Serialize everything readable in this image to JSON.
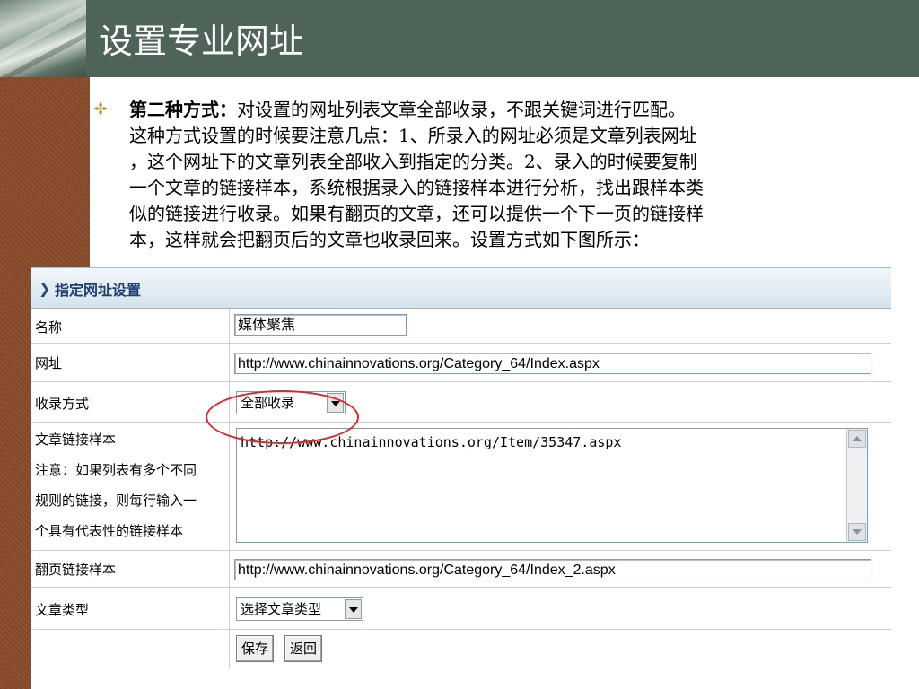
{
  "slide": {
    "title": "设置专业网址",
    "paragraph": {
      "lead": "第二种方式：",
      "line1_rest": "对设置的网址列表文章全部收录，不跟关键词进行匹配。",
      "line2": "这种方式设置的时候要注意几点：1、所录入的网址必须是文章列表网址",
      "line3": "，这个网址下的文章列表全部收入到指定的分类。2、录入的时候要复制",
      "line4": "一个文章的链接样本，系统根据录入的链接样本进行分析，找出跟样本类",
      "line5": "似的链接进行收录。如果有翻页的文章，还可以提供一个下一页的链接样",
      "line6": "本，这样就会把翻页后的文章也收录回来。设置方式如下图所示："
    }
  },
  "form": {
    "panel_title": "指定网址设置",
    "name_label": "名称",
    "name_value": "媒体聚焦",
    "url_label": "网址",
    "url_value": "http://www.chinainnovations.org/Category_64/Index.aspx",
    "mode_label": "收录方式",
    "mode_value": "全部收录",
    "sample_label_1": "文章链接样本",
    "sample_label_2": "注意：如果列表有多个不同",
    "sample_label_3": "规则的链接，则每行输入一",
    "sample_label_4": "个具有代表性的链接样本",
    "sample_value": "http://www.chinainnovations.org/Item/35347.aspx",
    "page_label": "翻页链接样本",
    "page_value": "http://www.chinainnovations.org/Category_64/Index_2.aspx",
    "type_label": "文章类型",
    "type_value": "选择文章类型",
    "save_label": "保存",
    "back_label": "返回"
  },
  "colors": {
    "header_bg": "#4f6458",
    "accent_bar": "#8a4a2a",
    "highlight_ellipse": "#e0242a",
    "bullet": "#b59a3c"
  }
}
